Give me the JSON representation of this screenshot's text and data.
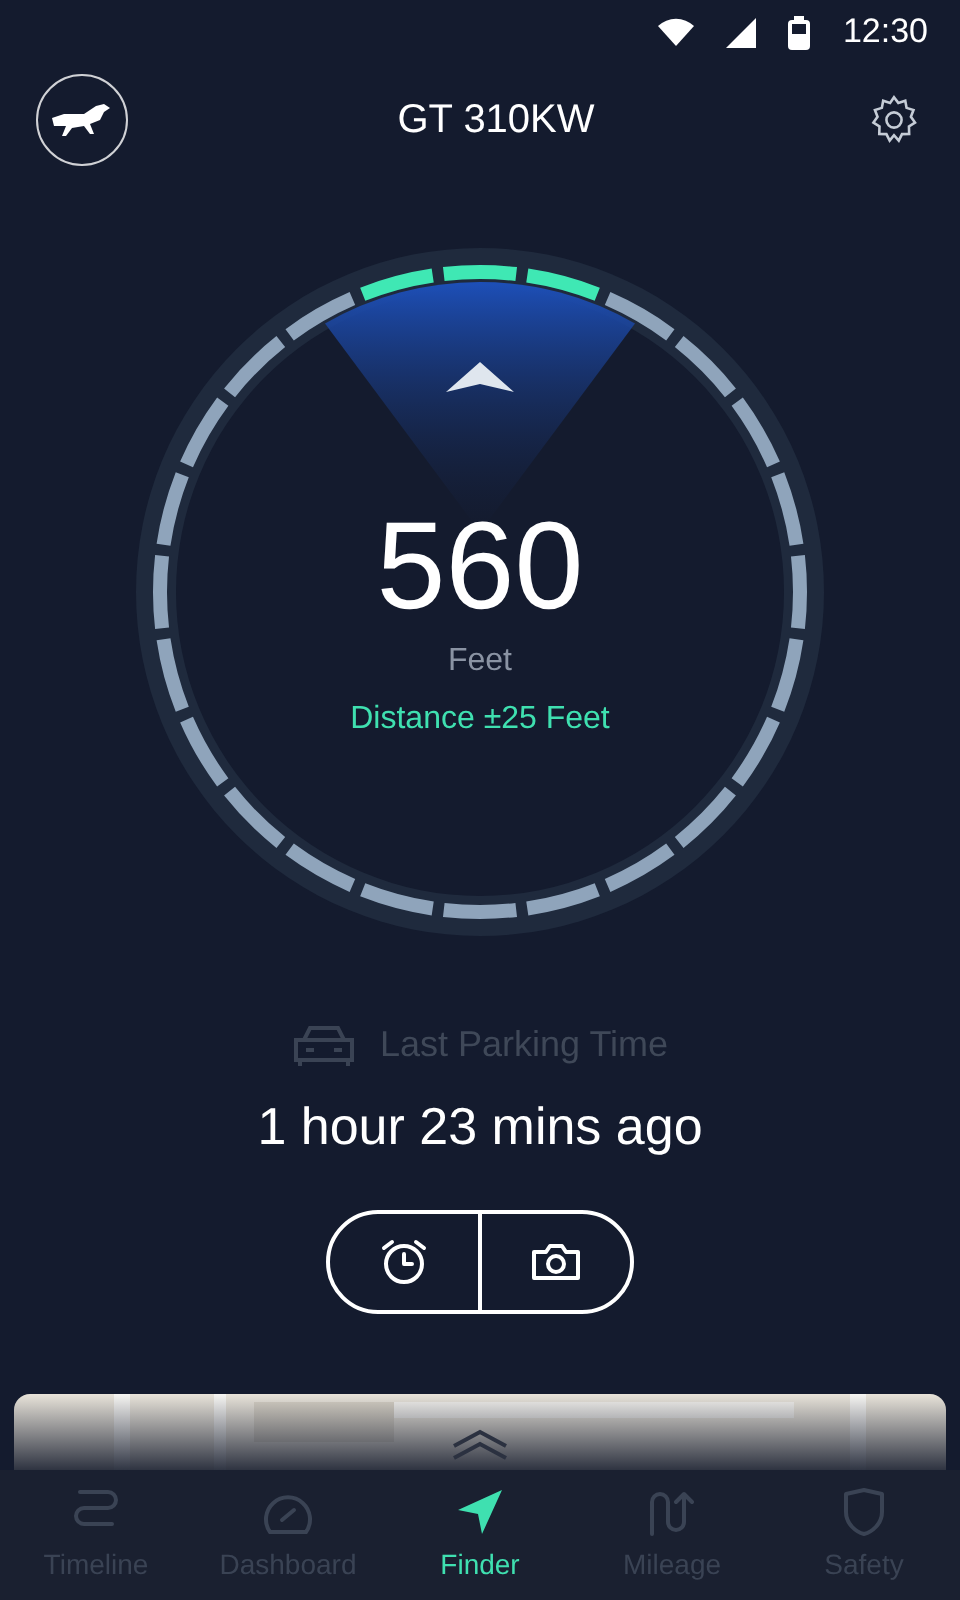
{
  "status_bar": {
    "time": "12:30"
  },
  "header": {
    "title": "GT 310KW"
  },
  "finder": {
    "distance": "560",
    "unit": "Feet",
    "accuracy": "Distance ±25 Feet"
  },
  "parking": {
    "label": "Last Parking Time",
    "elapsed": "1 hour 23 mins ago"
  },
  "actions": [
    {
      "kind": "alarm"
    },
    {
      "kind": "camera"
    }
  ],
  "nav": [
    {
      "label": "Timeline",
      "kind": "timeline",
      "selected": false
    },
    {
      "label": "Dashboard",
      "kind": "dashboard",
      "selected": false
    },
    {
      "label": "Finder",
      "kind": "finder",
      "selected": true
    },
    {
      "label": "Mileage",
      "kind": "mileage",
      "selected": false
    },
    {
      "label": "Safety",
      "kind": "safety",
      "selected": false
    }
  ]
}
